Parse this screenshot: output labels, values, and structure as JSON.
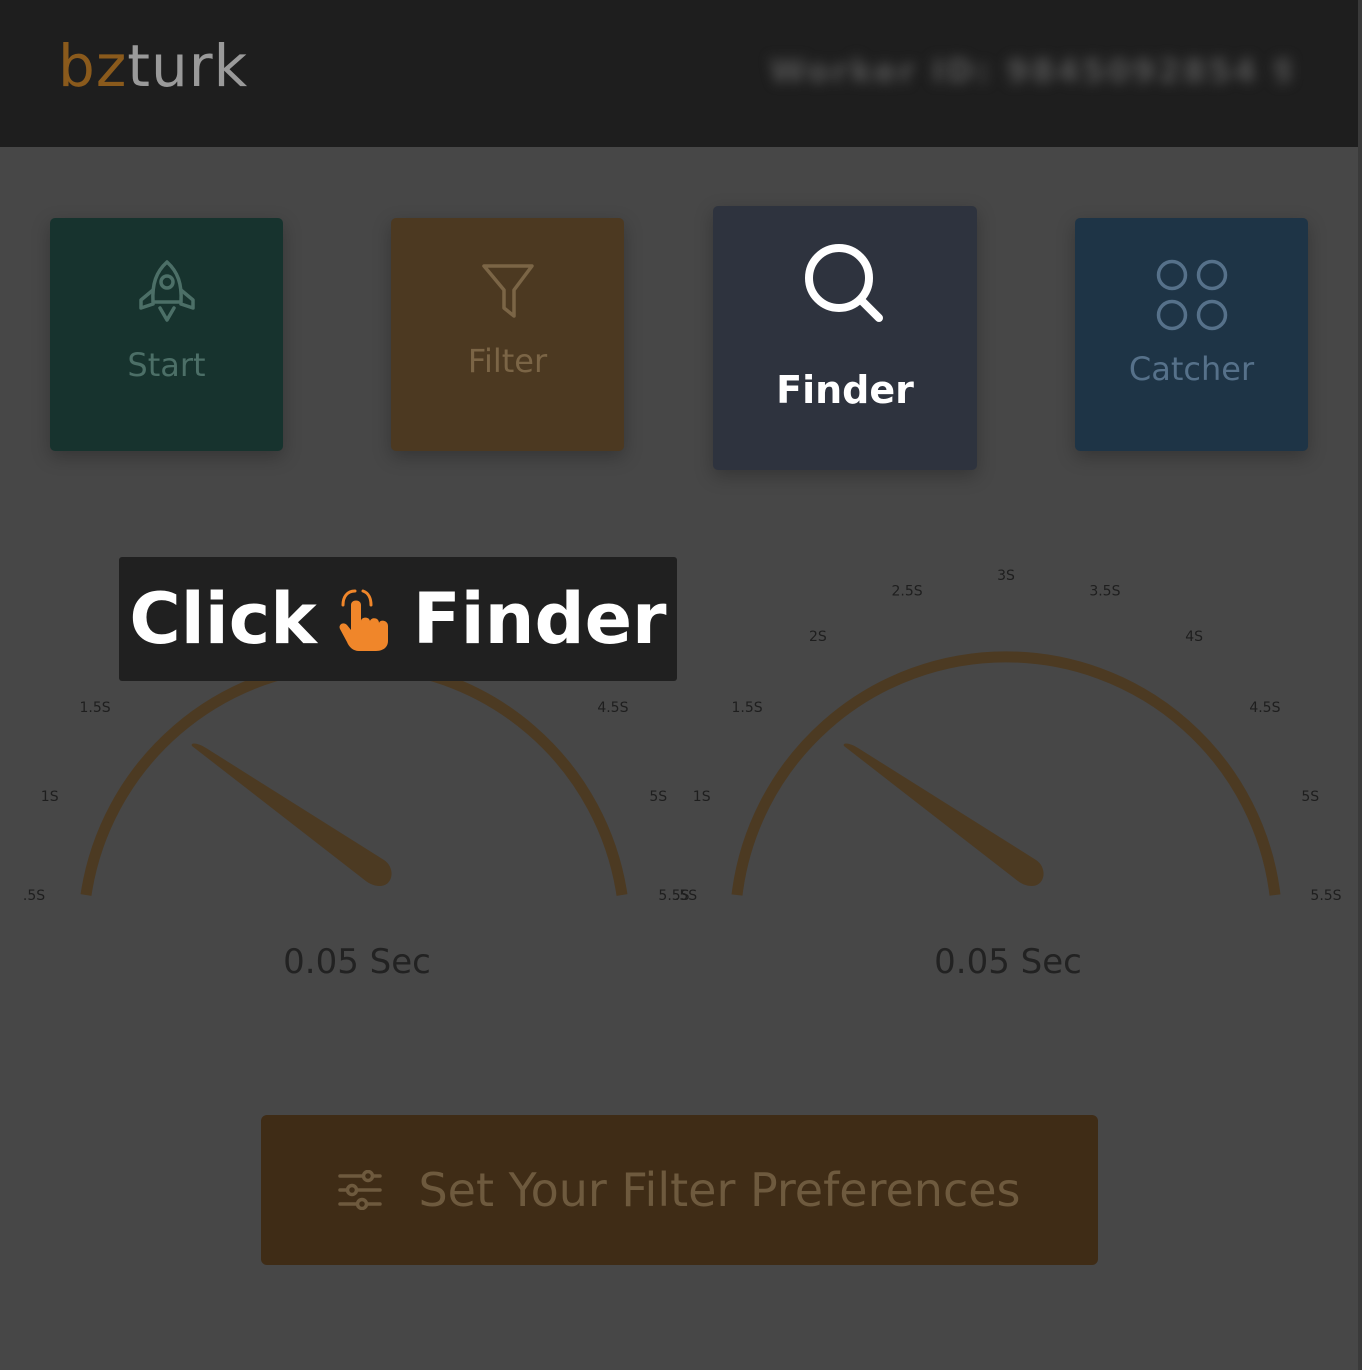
{
  "header": {
    "logo_part1": "bz",
    "logo_part2": "turk",
    "worker_id": "Worker ID: 9845092854 98"
  },
  "nav_cards": {
    "start": "Start",
    "filter": "Filter",
    "finder": "Finder",
    "catcher": "Catcher"
  },
  "banner": {
    "word1": "Click",
    "word2": "Finder"
  },
  "gauges": {
    "left": {
      "value_text": "0.05 Sec"
    },
    "right": {
      "value_text": "0.05 Sec"
    },
    "tick_labels": [
      ".5S",
      "1S",
      "1.5S",
      "2S",
      "2.5S",
      "3S",
      "3.5S",
      "4S",
      "4.5S",
      "5S",
      "5.5S"
    ]
  },
  "preferences_button": {
    "label": "Set Your Filter Preferences"
  },
  "colors": {
    "accent": "#4c3a22",
    "header_bg": "#1e1e1e",
    "page_bg": "#474747"
  }
}
